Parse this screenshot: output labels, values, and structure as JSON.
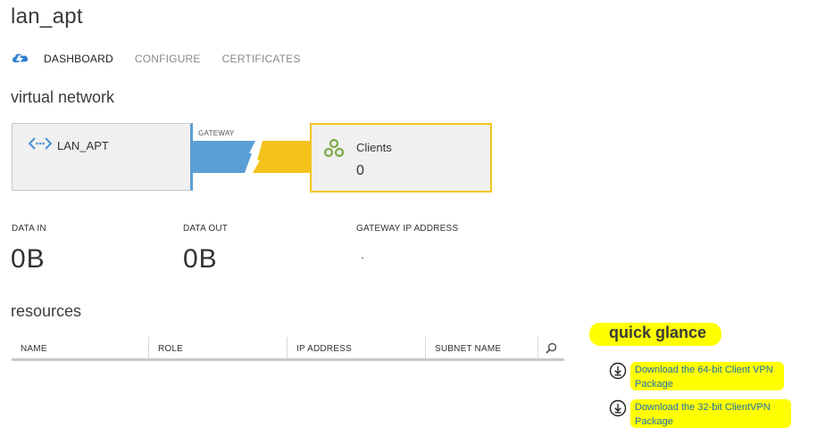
{
  "page": {
    "title": "lan_apt"
  },
  "tabs": [
    {
      "label": "DASHBOARD",
      "active": true
    },
    {
      "label": "CONFIGURE",
      "active": false
    },
    {
      "label": "CERTIFICATES",
      "active": false
    }
  ],
  "virtual_network": {
    "title": "virtual network",
    "network_name": "LAN_APT",
    "gateway_label": "GATEWAY",
    "clients_label": "Clients",
    "clients_count": "0"
  },
  "stats": {
    "data_in_label": "DATA IN",
    "data_in_value": "0B",
    "data_out_label": "DATA OUT",
    "data_out_value": "0B",
    "gateway_ip_label": "GATEWAY IP ADDRESS"
  },
  "resources": {
    "title": "resources",
    "columns": [
      "NAME",
      "ROLE",
      "IP ADDRESS",
      "SUBNET NAME"
    ]
  },
  "quick_glance": {
    "title": "quick glance",
    "links": [
      {
        "label": "Download the 64-bit Client VPN Package"
      },
      {
        "label": "Download the 32-bit ClientVPN Package"
      }
    ]
  },
  "colors": {
    "accent_blue": "#5a9fd6",
    "gateway_yellow": "#f4c21b",
    "link_blue": "#1f6fb2",
    "highlight": "#ffff00",
    "clients_green": "#7fa94a"
  },
  "icons": {
    "tab_cloud": "cloud-icon",
    "network": "network-icon",
    "clients": "clients-icon",
    "search": "search-icon",
    "download": "download-icon"
  }
}
